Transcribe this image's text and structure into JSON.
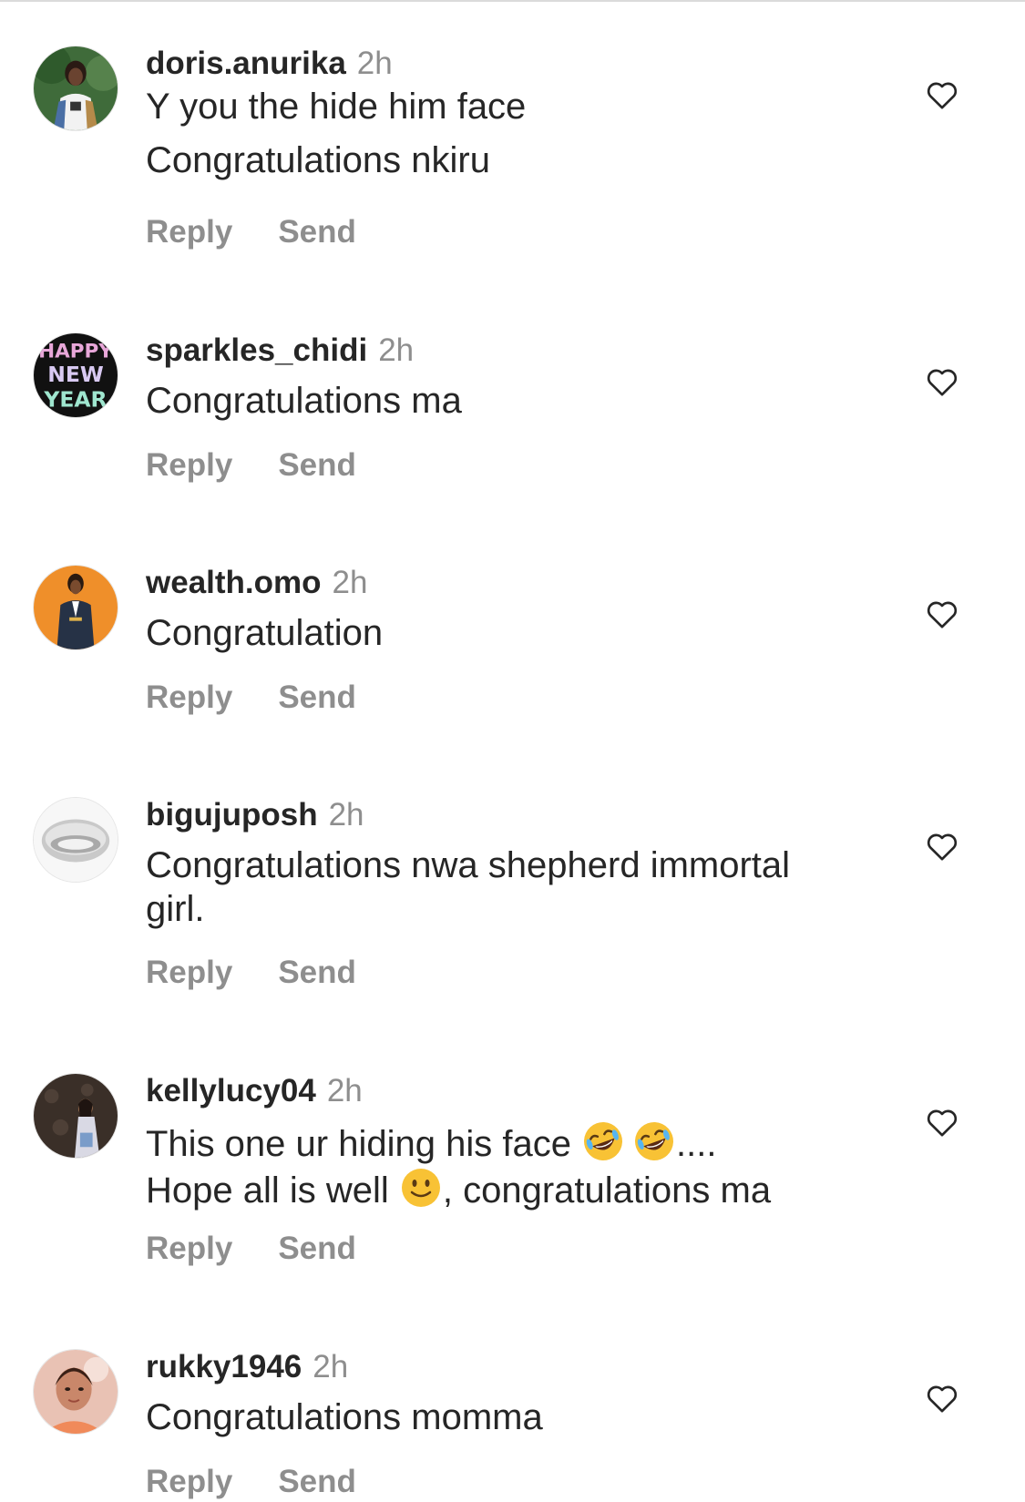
{
  "actions": {
    "reply_label": "Reply",
    "send_label": "Send"
  },
  "icons": {
    "like": "heart-outline-icon",
    "laugh_emoji": "rolling-on-floor-laughing-emoji",
    "smile_emoji": "slightly-smiling-face-emoji"
  },
  "colors": {
    "text": "#262626",
    "secondary": "#8e8e8e",
    "divider": "#dbdbdb"
  },
  "comments": [
    {
      "username": "doris.anurika",
      "time": "2h",
      "lines": [
        "Y you the hide him face",
        "Congratulations nkiru"
      ]
    },
    {
      "username": "sparkles_chidi",
      "time": "2h",
      "lines": [
        "Congratulations ma"
      ],
      "avatar_text": [
        "HAPPY",
        "NEW",
        "YEAR"
      ]
    },
    {
      "username": "wealth.omo",
      "time": "2h",
      "lines": [
        "Congratulation"
      ]
    },
    {
      "username": "bigujuposh",
      "time": "2h",
      "lines": [
        "Congratulations nwa shepherd immortal",
        "girl."
      ]
    },
    {
      "username": "kellylucy04",
      "time": "2h",
      "line1_text": "This one ur hiding his face ",
      "line1_suffix": "....",
      "line2_text": "Hope all is well ",
      "line2_suffix": ", congratulations ma"
    },
    {
      "username": "rukky1946",
      "time": "2h",
      "lines": [
        "Congratulations momma"
      ]
    }
  ]
}
